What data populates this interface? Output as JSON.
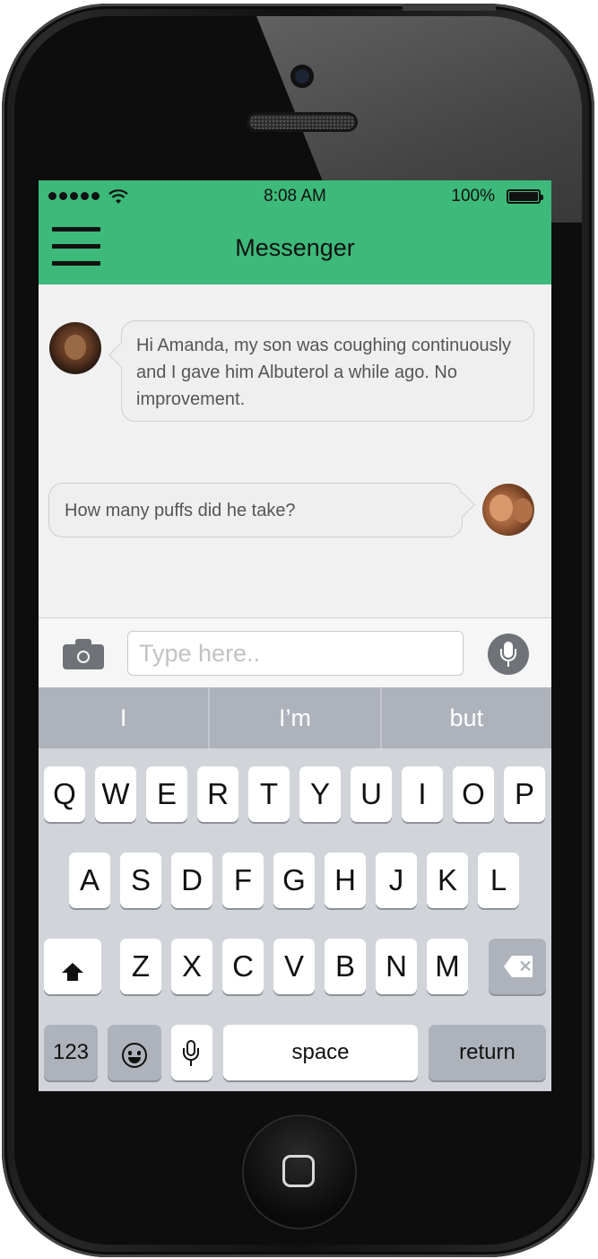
{
  "status_bar": {
    "time": "8:08 AM",
    "battery_percent": "100%",
    "wifi_glyph": "▽"
  },
  "header": {
    "title": "Messenger"
  },
  "messages": [
    {
      "direction": "incoming",
      "text": "Hi Amanda, my son was coughing continuously and I gave him Albuterol a while ago. No improvement."
    },
    {
      "direction": "outgoing",
      "text": "How many puffs did he take?"
    }
  ],
  "composer": {
    "placeholder": "Type here..",
    "value": ""
  },
  "keyboard": {
    "predictions": [
      "I",
      "I’m",
      "but"
    ],
    "row1": [
      "Q",
      "W",
      "E",
      "R",
      "T",
      "Y",
      "U",
      "I",
      "O",
      "P"
    ],
    "row2": [
      "A",
      "S",
      "D",
      "F",
      "G",
      "H",
      "J",
      "K",
      "L"
    ],
    "row3": [
      "Z",
      "X",
      "C",
      "V",
      "B",
      "N",
      "M"
    ],
    "numbers_key": "123",
    "space_key": "space",
    "return_key": "return",
    "delete_glyph": "✕"
  },
  "colors": {
    "accent": "#3db97a",
    "icon_gray": "#6f7378",
    "keyboard_bg": "#d1d4d9"
  },
  "icons": [
    "menu-icon",
    "camera-icon",
    "microphone-icon",
    "shift-icon",
    "delete-icon",
    "emoji-icon",
    "wifi-icon",
    "battery-icon",
    "signal-icon"
  ]
}
